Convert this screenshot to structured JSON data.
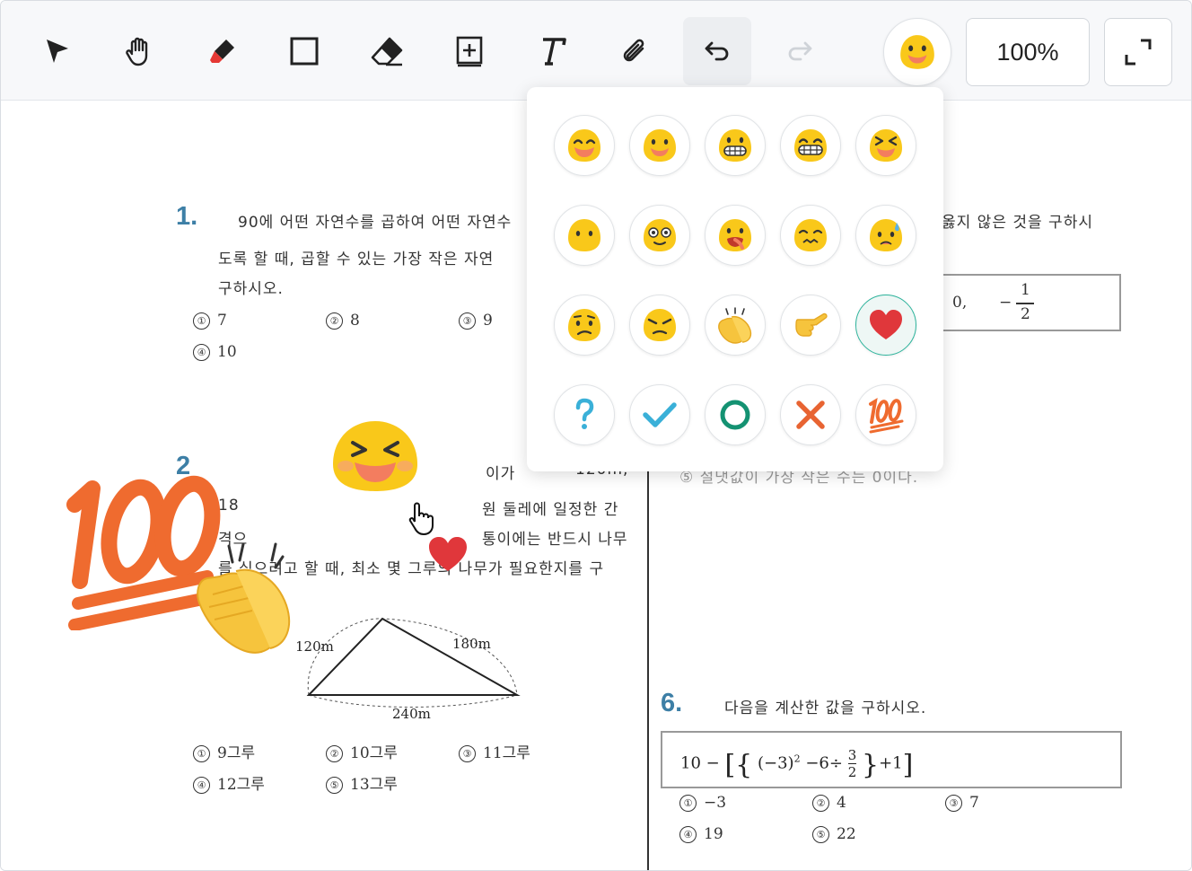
{
  "toolbar": {
    "tools": [
      {
        "name": "select",
        "icon": "arrow-pointer-icon"
      },
      {
        "name": "pan",
        "icon": "hand-icon"
      },
      {
        "name": "pen",
        "icon": "marker-icon"
      },
      {
        "name": "rectangle",
        "icon": "square-icon"
      },
      {
        "name": "eraser",
        "icon": "eraser-icon"
      },
      {
        "name": "add-box",
        "icon": "plus-box-icon"
      },
      {
        "name": "text",
        "icon": "text-t-icon"
      },
      {
        "name": "attach",
        "icon": "paperclip-icon"
      },
      {
        "name": "undo",
        "icon": "undo-icon"
      },
      {
        "name": "redo",
        "icon": "redo-icon"
      }
    ],
    "zoom": "100%",
    "emoji_button_icon": "smile-face-icon",
    "expand_icon": "expand-corners-icon"
  },
  "picker": {
    "rows": [
      [
        "laugh-face",
        "smile-face",
        "grin-face",
        "big-grin-face",
        "squint-laugh-face"
      ],
      [
        "neutral-face",
        "flushed-face",
        "tongue-face",
        "weary-face",
        "sweat-face"
      ],
      [
        "confused-face",
        "angry-face",
        "clapping-hands",
        "thumb-hand",
        "heart"
      ],
      [
        "question-mark",
        "check-mark",
        "circle-o",
        "cross-x",
        "hundred-points"
      ]
    ],
    "selected": "heart",
    "colors": {
      "face": "#f9c81a",
      "blush": "#f37d5f",
      "heart": "#e0373b",
      "check": "#3ab0d8",
      "circle": "#149272",
      "cross": "#e86432",
      "hundred": "#ef6b2f"
    }
  },
  "document": {
    "q1": {
      "number": "1.",
      "lines": [
        "90에 어떤 자연수를 곱하여 어떤 자연수",
        "도록 할 때, 곱할 수 있는 가장 작은 자연",
        "구하시오."
      ],
      "choices": [
        [
          "①",
          "7"
        ],
        [
          "②",
          "8"
        ],
        [
          "③",
          "9"
        ],
        [
          "④",
          "10"
        ]
      ]
    },
    "q2": {
      "number": "2",
      "lines": [
        "이가",
        "120m,",
        "원 둘레에 일정한 간",
        "18",
        "격으",
        "통이에는 반드시 나무",
        "를 심으려고 할 때, 최소 몇 그루의 나무가 필요한지를 구"
      ],
      "triangle_labels": [
        "120m",
        "180m",
        "240m"
      ],
      "choices": [
        [
          "①",
          "9그루"
        ],
        [
          "②",
          "10그루"
        ],
        [
          "③",
          "11그루"
        ],
        [
          "④",
          "12그루"
        ],
        [
          "⑤",
          "13그루"
        ]
      ]
    },
    "q_right_top": {
      "text": "옳지 않은 것을 구하시",
      "underline": "않은",
      "box_values": [
        "0,",
        "−",
        "1",
        "2"
      ]
    },
    "q_right_partial": "⑤ 절댓값이 가장 작은 수는 0이다.",
    "q6": {
      "number": "6.",
      "text": "다음을 계산한 값을 구하시오.",
      "expression": "10 − [{(−3)² − 6 ÷ 3/2} + 1]",
      "expr_parts": {
        "a": "10",
        "b": "(−3)",
        "exp": "2",
        "c": "−6÷",
        "num": "3",
        "den": "2",
        "d": "+1"
      },
      "choices": [
        [
          "①",
          "−3"
        ],
        [
          "②",
          "4"
        ],
        [
          "③",
          "7"
        ],
        [
          "④",
          "19"
        ],
        [
          "⑤",
          "22"
        ]
      ]
    }
  },
  "stickers": [
    "squint-laugh-face",
    "hundred-points",
    "clapping-hands",
    "heart",
    "hand-cursor"
  ]
}
